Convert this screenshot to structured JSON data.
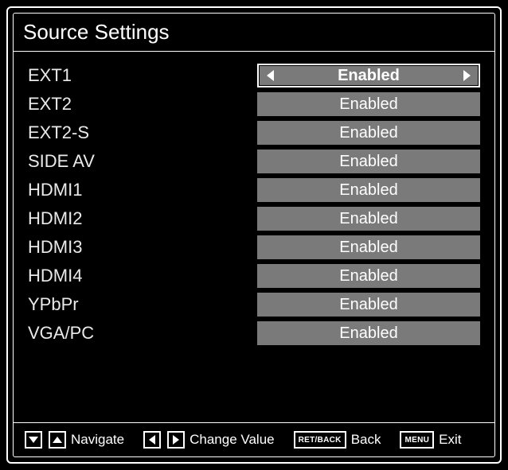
{
  "title": "Source Settings",
  "sources": [
    {
      "label": "EXT1",
      "value": "Enabled",
      "selected": true
    },
    {
      "label": "EXT2",
      "value": "Enabled",
      "selected": false
    },
    {
      "label": "EXT2-S",
      "value": "Enabled",
      "selected": false
    },
    {
      "label": "SIDE AV",
      "value": "Enabled",
      "selected": false
    },
    {
      "label": "HDMI1",
      "value": "Enabled",
      "selected": false
    },
    {
      "label": "HDMI2",
      "value": "Enabled",
      "selected": false
    },
    {
      "label": "HDMI3",
      "value": "Enabled",
      "selected": false
    },
    {
      "label": "HDMI4",
      "value": "Enabled",
      "selected": false
    },
    {
      "label": "YPbPr",
      "value": "Enabled",
      "selected": false
    },
    {
      "label": "VGA/PC",
      "value": "Enabled",
      "selected": false
    }
  ],
  "footer": {
    "navigate": "Navigate",
    "change_value": "Change Value",
    "back_key": "RET/BACK",
    "back": "Back",
    "menu_key": "MENU",
    "exit": "Exit"
  }
}
